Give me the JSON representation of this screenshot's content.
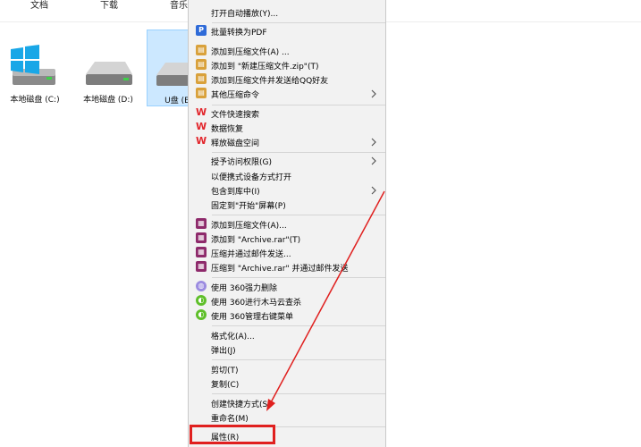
{
  "quick_access": {
    "documents": "文档",
    "downloads": "下载",
    "music": "音乐"
  },
  "drives": [
    {
      "label": "本地磁盘 (C:)",
      "icon": "windows-drive-icon"
    },
    {
      "label": "本地磁盘 (D:)",
      "icon": "hard-drive-icon"
    },
    {
      "label": "U盘 (E",
      "icon": "usb-drive-icon"
    }
  ],
  "menu": {
    "items": [
      {
        "label": "打开自动播放(Y)...",
        "icon": ""
      },
      {
        "label": "批量转换为PDF",
        "icon": "pdf-icon"
      },
      {
        "label": "添加到压缩文件(A) ...",
        "icon": "archive-icon"
      },
      {
        "label": "添加到 \"新建压缩文件.zip\"(T)",
        "icon": "archive-icon"
      },
      {
        "label": "添加到压缩文件并发送给QQ好友",
        "icon": "archive-icon"
      },
      {
        "label": "其他压缩命令",
        "icon": "archive-icon",
        "submenu": true
      },
      {
        "label": "文件快速搜索",
        "icon": "wps-icon"
      },
      {
        "label": "数据恢复",
        "icon": "wps-icon"
      },
      {
        "label": "释放磁盘空间",
        "icon": "wps-icon",
        "submenu": true
      },
      {
        "label": "授予访问权限(G)",
        "icon": "",
        "submenu": true
      },
      {
        "label": "以便携式设备方式打开",
        "icon": ""
      },
      {
        "label": "包含到库中(I)",
        "icon": "",
        "submenu": true
      },
      {
        "label": "固定到\"开始\"屏幕(P)",
        "icon": ""
      },
      {
        "label": "添加到压缩文件(A)...",
        "icon": "winrar-icon"
      },
      {
        "label": "添加到 \"Archive.rar\"(T)",
        "icon": "winrar-icon"
      },
      {
        "label": "压缩并通过邮件发送...",
        "icon": "winrar-icon"
      },
      {
        "label": "压缩到 \"Archive.rar\" 并通过邮件发送",
        "icon": "winrar-icon"
      },
      {
        "label": "使用 360强力删除",
        "icon": "360-shred-icon"
      },
      {
        "label": "使用 360进行木马云查杀",
        "icon": "360-scan-icon"
      },
      {
        "label": "使用 360管理右键菜单",
        "icon": "360-manage-icon"
      },
      {
        "label": "格式化(A)...",
        "icon": ""
      },
      {
        "label": "弹出(J)",
        "icon": ""
      },
      {
        "label": "剪切(T)",
        "icon": ""
      },
      {
        "label": "复制(C)",
        "icon": ""
      },
      {
        "label": "创建快捷方式(S)",
        "icon": ""
      },
      {
        "label": "重命名(M)",
        "icon": ""
      },
      {
        "label": "属性(R)",
        "icon": ""
      }
    ]
  },
  "colors": {
    "menu_bg": "#f2f2f2",
    "highlight": "#e0201f",
    "selection": "#cce8ff"
  }
}
